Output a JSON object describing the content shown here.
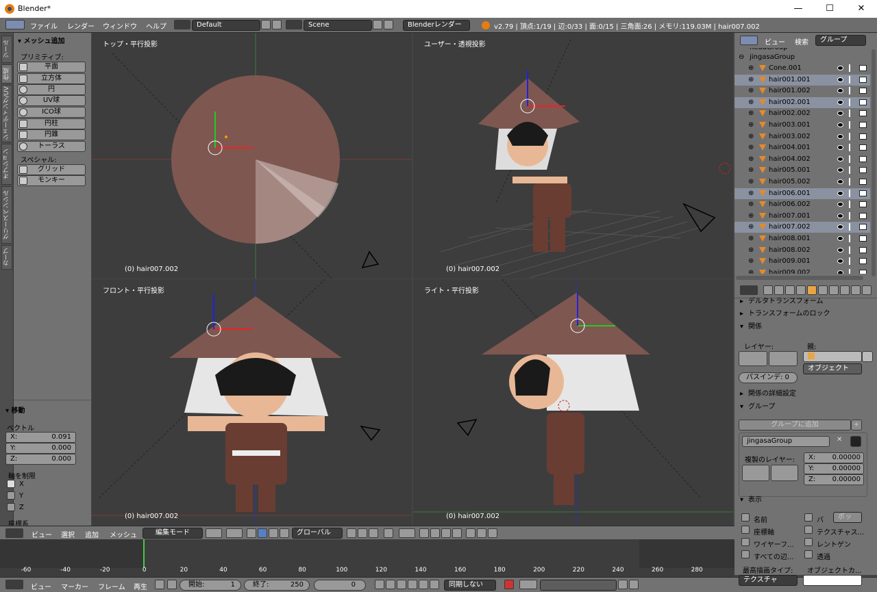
{
  "window": {
    "title": "Blender*",
    "minimize": "—",
    "maximize": "☐",
    "close": "✕"
  },
  "menu": {
    "items": [
      "ファイル",
      "レンダー",
      "ウィンドウ",
      "ヘルプ"
    ],
    "layout": "Default",
    "scene": "Scene",
    "engine": "Blenderレンダー",
    "stats": "v2.79 | 頂点:1/19 | 辺:0/33 | 面:0/15 | 三角面:26 | メモリ:119.03M | hair007.002"
  },
  "tabs": [
    "ツール",
    "作成",
    "シェーディング/UV",
    "オプション",
    "グリースペンシル",
    "カーブ"
  ],
  "toolshelf": {
    "header": "メッシュ追加",
    "primitive_label": "プリミティブ:",
    "primitives": [
      "平面",
      "立方体",
      "円",
      "UV球",
      "ICO球",
      "円柱",
      "円錐",
      "トーラス"
    ],
    "special_label": "スペシャル:",
    "specials": [
      "グリッド",
      "モンキー"
    ]
  },
  "operator": {
    "header": "移動",
    "vector_label": "ベクトル",
    "x_label": "X:",
    "x": "0.091",
    "y_label": "Y:",
    "y": "0.000",
    "z_label": "Z:",
    "z": "0.000",
    "constraint_label": "軸を制限",
    "axes": [
      "X",
      "Y",
      "Z"
    ],
    "orientation_label": "座標系"
  },
  "viewports": {
    "top": {
      "title": "トップ・平行投影",
      "object": "(0) hair007.002"
    },
    "user": {
      "title": "ユーザー・透視投影",
      "object": "(0) hair007.002"
    },
    "front": {
      "title": "フロント・平行投影",
      "object": "(0) hair007.002"
    },
    "right": {
      "title": "ライト・平行投影",
      "object": "(0) hair007.002"
    }
  },
  "outliner": {
    "tabs": [
      "ビュー",
      "検索",
      "グループ"
    ],
    "partial_row": "headGroup",
    "group": "jingasaGroup",
    "rows": [
      "Cone.001",
      "hair001.001",
      "hair001.002",
      "hair002.001",
      "hair002.002",
      "hair003.001",
      "hair003.002",
      "hair004.001",
      "hair004.002",
      "hair005.001",
      "hair005.002",
      "hair006.001",
      "hair006.002",
      "hair007.001",
      "hair007.002",
      "hair008.001",
      "hair008.002",
      "hair009.001",
      "hair009.002"
    ],
    "selected_rows": [
      1,
      3,
      11,
      14
    ]
  },
  "properties": {
    "partial_header": "デルタトランスフォーム",
    "lock_header": "トランスフォームのロック",
    "relations_header": "関係",
    "layer_label": "レイヤー:",
    "parent_label": "親:",
    "parent_type": "オブジェクト",
    "pass_index": "パスインデ: 0",
    "relations_extra": "関係の詳細設定",
    "group_header": "グループ",
    "add_to_group": "グループに追加",
    "group_name": "jingasaGroup",
    "dupli_layer_label": "複製のレイヤー:",
    "dx_label": "X:",
    "dx": "0.00000",
    "dy_label": "Y:",
    "dy": "0.00000",
    "dz_label": "Z:",
    "dz": "0.00000",
    "display_header": "表示",
    "display_left": [
      "名前",
      "座標軸",
      "ワイヤーフ...",
      "すべての辺..."
    ],
    "display_right": [
      "バ",
      "テクスチャス...",
      "レントゲン",
      "透過"
    ],
    "bound_type": "ボッ",
    "max_draw_label": "最高描画タイプ:",
    "max_draw": "テクスチャ",
    "obj_color_label": "オブジェクトカ..."
  },
  "viewport_header": {
    "menus": [
      "ビュー",
      "選択",
      "追加",
      "メッシュ"
    ],
    "mode": "編集モード",
    "orientation": "グローバル"
  },
  "timeline": {
    "ticks": [
      "-60",
      "-40",
      "-20",
      "0",
      "20",
      "40",
      "60",
      "80",
      "100",
      "120",
      "140",
      "160",
      "180",
      "200",
      "220",
      "240",
      "260",
      "280"
    ],
    "menus": [
      "ビュー",
      "マーカー",
      "フレーム",
      "再生"
    ],
    "start_label": "開始:",
    "start": "1",
    "end_label": "終了:",
    "end": "250",
    "current": "0",
    "sync": "同期しない"
  }
}
